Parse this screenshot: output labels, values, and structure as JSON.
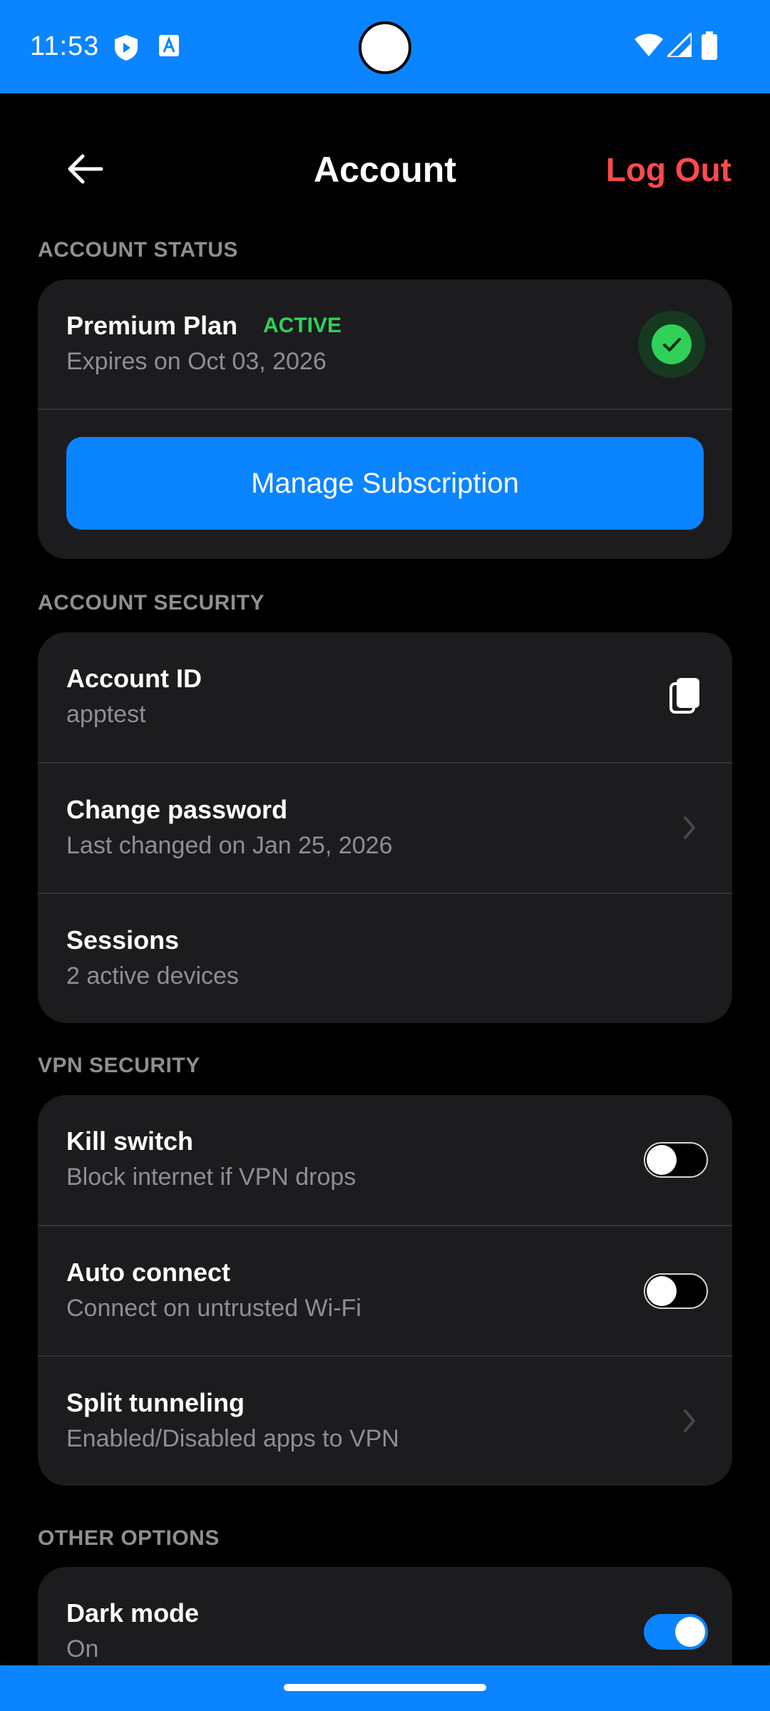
{
  "status_bar": {
    "time": "11:53",
    "left_icons": [
      "shield-icon",
      "accessibility-icon"
    ],
    "right_icons": [
      "wifi-icon",
      "signal-icon",
      "battery-icon"
    ]
  },
  "header": {
    "title": "Account",
    "logout_label": "Log Out",
    "back_icon": "back-arrow-icon"
  },
  "account_status": {
    "section_label": "ACCOUNT STATUS",
    "plan_name": "Premium Plan",
    "badge": "ACTIVE",
    "expires": "Expires on Oct 03, 2026",
    "manage_label": "Manage Subscription"
  },
  "account_security": {
    "section_label": "ACCOUNT SECURITY",
    "items": [
      {
        "title": "Account ID",
        "subtitle": "apptest",
        "action": "copy-icon"
      },
      {
        "title": "Change password",
        "subtitle": "Last changed on Jan 25, 2026",
        "action": "chevron-right-icon"
      },
      {
        "title": "Sessions",
        "subtitle": "2 active devices",
        "action": ""
      }
    ]
  },
  "vpn_security": {
    "section_label": "VPN SECURITY",
    "items": [
      {
        "title": "Kill switch",
        "subtitle": "Block internet if VPN drops",
        "toggle_on": false
      },
      {
        "title": "Auto connect",
        "subtitle": "Connect on untrusted Wi-Fi",
        "toggle_on": false
      },
      {
        "title": "Split tunneling",
        "subtitle": "Enabled/Disabled apps to VPN",
        "action": "chevron-right-icon"
      }
    ]
  },
  "other_options": {
    "section_label": "OTHER OPTIONS",
    "items": [
      {
        "title": "Dark mode",
        "subtitle": "On",
        "toggle_on": true
      }
    ]
  },
  "colors": {
    "accent": "#0a84ff",
    "danger": "#ff4a4a",
    "success": "#30d158",
    "card": "#1c1c1e",
    "background": "#000000"
  }
}
